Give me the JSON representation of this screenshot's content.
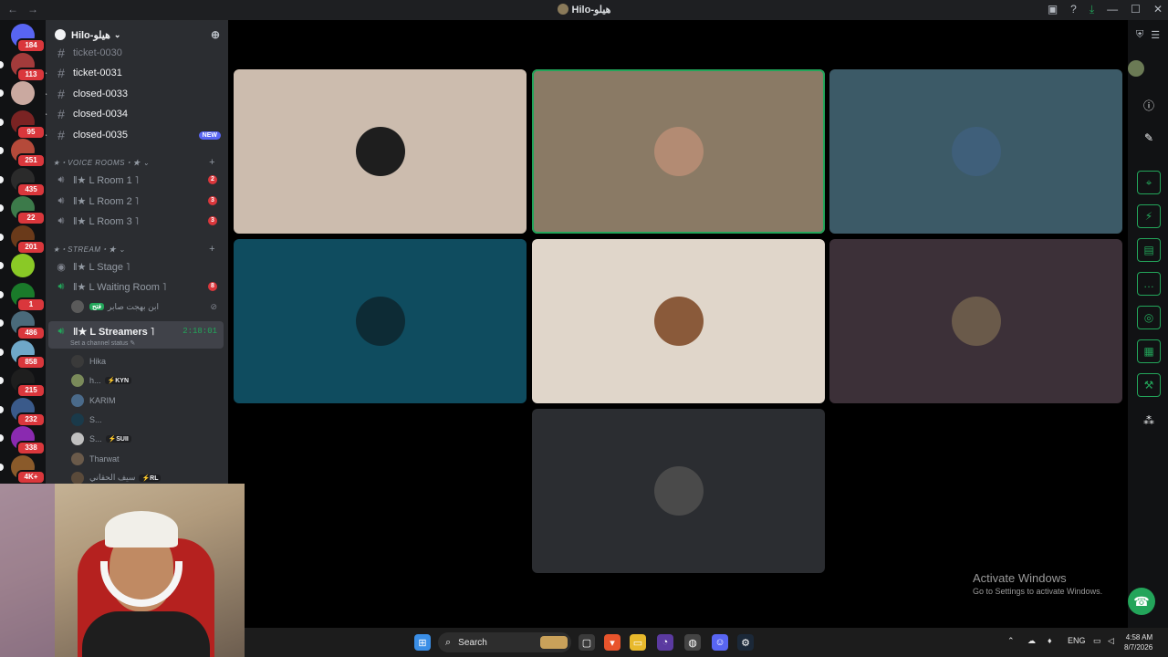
{
  "window": {
    "title": "Hilo-هيلو",
    "nav_back": "←",
    "nav_forward": "→",
    "tools": [
      "inbox-icon",
      "help-icon",
      "download-icon",
      "minimize-icon",
      "maximize-icon",
      "close-icon"
    ]
  },
  "guilds": [
    {
      "badge": "184",
      "color": "#5865f2"
    },
    {
      "badge": "113",
      "color": "#a23b3b"
    },
    {
      "badge": "",
      "color": "#caa9a0"
    },
    {
      "badge": "95",
      "color": "#7a2323"
    },
    {
      "badge": "251",
      "color": "#b54a3a"
    },
    {
      "badge": "435",
      "color": "#2b2b2b"
    },
    {
      "badge": "22",
      "color": "#3c7a4a"
    },
    {
      "badge": "201",
      "color": "#6a3a1a"
    },
    {
      "badge": "",
      "color": "#8ac926"
    },
    {
      "badge": "1",
      "color": "#1a7a2a"
    },
    {
      "badge": "486",
      "color": "#4a6a7a"
    },
    {
      "badge": "858",
      "color": "#6fa8c8"
    },
    {
      "badge": "215",
      "color": "#1e1e1e"
    },
    {
      "badge": "232",
      "color": "#3a5a8a"
    },
    {
      "badge": "338",
      "color": "#8a2ab0"
    },
    {
      "badge": "4K+",
      "color": "#8a5a2a"
    }
  ],
  "server": {
    "name": "Hilo-هيلو",
    "channels": [
      {
        "name": "ticket-0030",
        "dim": true,
        "arrow": false,
        "badge": ""
      },
      {
        "name": "ticket-0031",
        "dim": false,
        "arrow": true,
        "badge": ""
      },
      {
        "name": "closed-0033",
        "dim": false,
        "arrow": true,
        "badge": ""
      },
      {
        "name": "closed-0034",
        "dim": false,
        "arrow": true,
        "badge": ""
      },
      {
        "name": "closed-0035",
        "dim": false,
        "arrow": true,
        "badge": "NEW"
      }
    ],
    "voice_category": "★・VOICE ROOMS・★ ⌄",
    "voice_rooms": [
      {
        "name": "‖★ L Room 1 ˥",
        "count": "2"
      },
      {
        "name": "‖★ L Room 2 ˥",
        "count": "3"
      },
      {
        "name": "‖★ L Room 3 ˥",
        "count": "3"
      }
    ],
    "stream_category": "★・STREAM・★ ⌄",
    "stage": {
      "name": "‖★ L Stage ˥"
    },
    "waiting_room": {
      "name": "‖★ L Waiting Room ˥",
      "count": "8"
    },
    "waiting_member": {
      "name": "ابن بهجت صابر",
      "tag": "فتح"
    },
    "streamers": {
      "name": "‖★ L Streamers ˥",
      "timer": "2:18:01",
      "status": "Set a channel status ✎"
    },
    "members": [
      {
        "name": "Hika",
        "tag": "",
        "color": "#3a3a3a"
      },
      {
        "name": "h...",
        "tag": "⚡KYN",
        "color": "#7a8a5a"
      },
      {
        "name": "KARIM",
        "tag": "",
        "color": "#4a6a8a"
      },
      {
        "name": "S...",
        "tag": "",
        "color": "#1a3a4a"
      },
      {
        "name": "S...",
        "tag": "⚡SUII",
        "color": "#c0c0c0"
      },
      {
        "name": "Tharwat",
        "tag": "",
        "color": "#6a5a4a"
      },
      {
        "name": "سيف الحقاني",
        "tag": "⚡RL",
        "color": "#5a4a3a"
      }
    ]
  },
  "tiles": [
    {
      "name": "participant-1",
      "bg": "#ccbcae",
      "face": "#1e1e1e",
      "speaking": false
    },
    {
      "name": "participant-2",
      "bg": "#8a7a65",
      "face": "#b38b73",
      "speaking": true
    },
    {
      "name": "participant-3",
      "bg": "#3c5a67",
      "face": "#3f5f7a",
      "speaking": false
    },
    {
      "name": "participant-4",
      "bg": "#0f4c5f",
      "face": "#0d2b35",
      "speaking": false
    },
    {
      "name": "participant-5",
      "bg": "#e0d6ca",
      "face": "#8a5a3a",
      "speaking": false
    },
    {
      "name": "participant-6",
      "bg": "#3c3038",
      "face": "#6a5a4a",
      "speaking": false
    },
    {
      "name": "participant-7",
      "bg": "#2b2d31",
      "face": "#4a4a4a",
      "speaking": false
    }
  ],
  "rightbar": {
    "icons": [
      "info-icon",
      "pencil-icon",
      "screenshot-icon",
      "lightning-icon",
      "clipboard-icon",
      "chat-icon",
      "broadcast-icon",
      "media-icon",
      "wrench-icon",
      "nodes-icon"
    ]
  },
  "watermark": {
    "line1": "Activate Windows",
    "line2": "Go to Settings to activate Windows."
  },
  "taskbar": {
    "search_label": "Search",
    "lang": "ENG",
    "time": "4:58 AM",
    "date": "8/7/2026"
  },
  "colors": {
    "accent_green": "#23a55a",
    "badge_red": "#da373c",
    "blurple": "#5865f2"
  }
}
